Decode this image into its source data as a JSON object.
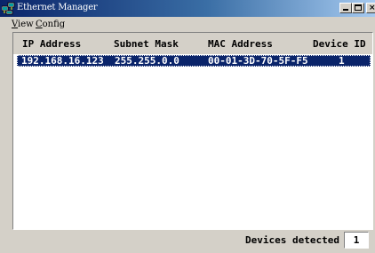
{
  "window": {
    "title": "Ethernet Manager",
    "title_bar_color": "#0a246a",
    "chrome_color": "#d4d0c8"
  },
  "title_buttons": {
    "minimize_icon": "minimize-icon",
    "maximize_icon": "maximize-icon",
    "close_icon": "close-icon",
    "close_glyph": "×"
  },
  "menu": {
    "view": {
      "mnemonic": "V",
      "rest": "iew"
    },
    "config": {
      "mnemonic": "C",
      "rest": "onfig"
    }
  },
  "device_list": {
    "columns": [
      "IP Address",
      "Subnet Mask",
      "MAC Address",
      "Device ID"
    ],
    "rows": [
      {
        "ip_address": "192.168.16.123",
        "subnet_mask": "255.255.0.0",
        "mac_address": "00-01-3D-70-5F-F5",
        "device_id": "1",
        "selected": true
      }
    ],
    "selection_color": "#0a246a"
  },
  "status": {
    "label": "Devices detected",
    "count": "1"
  }
}
